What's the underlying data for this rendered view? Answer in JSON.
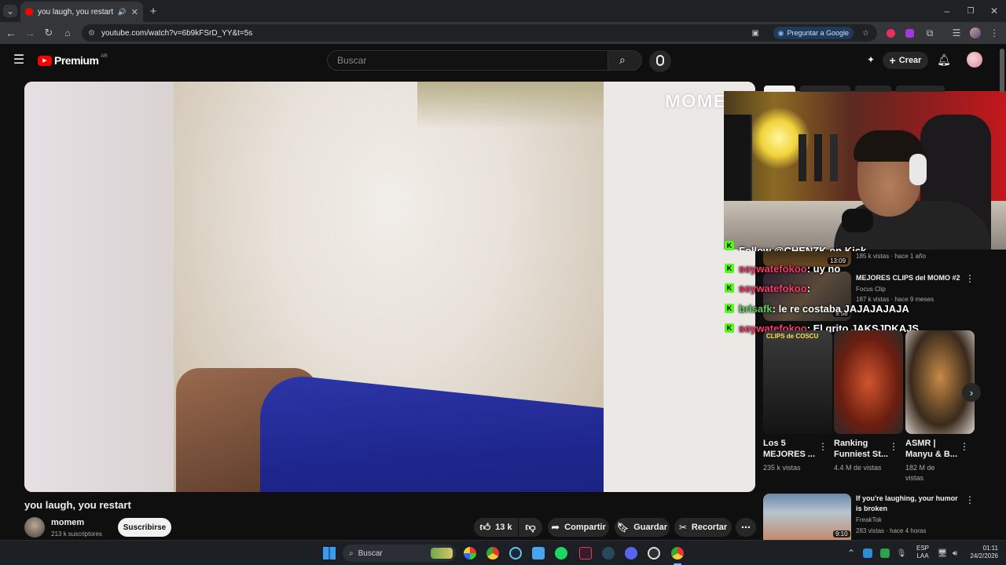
{
  "browser": {
    "tab_title": "you laugh, you restart - You",
    "url": "youtube.com/watch?v=6b9kFSrD_YY&t=5s",
    "ask_google": "Preguntar a Google"
  },
  "youtube": {
    "logo_text": "Premium",
    "logo_country": "AR",
    "search_placeholder": "Buscar",
    "create_label": "Crear"
  },
  "video": {
    "title": "you laugh, you restart",
    "watermark": "MOME",
    "channel_name": "momem",
    "subscribers": "213 k suscriptores",
    "subscribe_label": "Suscribirse",
    "likes": "13 k",
    "share_label": "Compartir",
    "save_label": "Guardar",
    "clip_label": "Recortar"
  },
  "chat": {
    "lines": [
      {
        "user": "soywatefokoo",
        "message": ": uy no",
        "user_color": "#ff3a6b"
      },
      {
        "user": "soywatefokoo",
        "message": ":",
        "user_color": "#ff3a6b"
      },
      {
        "user": "brisafk",
        "message": ": le re costaba JAJAJAJAJA",
        "user_color": "#5fd35f"
      },
      {
        "user": "soywatefokoo",
        "message": ": El grito JAKSJDKAJS",
        "user_color": "#ff3a6b"
      }
    ],
    "partial_line": "Follow @CHENZK on Kick"
  },
  "sidebar": {
    "partial_meta": "185 k vistas · hace 1 año",
    "partial_duration": "13:09",
    "rec1": {
      "title": "MEJORES CLIPS del MOMO #2",
      "channel": "Focus Clip",
      "meta": "187 k vistas · hace 9 meses",
      "duration": "9:58"
    },
    "shorts": [
      {
        "title": "Los 5 MEJORES ...",
        "views": "235 k vistas",
        "thumb_text": "CLIPS de COSCU"
      },
      {
        "title": "Ranking Funniest St...",
        "views": "4.4 M de vistas"
      },
      {
        "title": "ASMR | Manyu & B...",
        "views": "182 M de vistas"
      }
    ],
    "rec2": {
      "title": "If you're laughing, your humor is broken",
      "channel": "FreakTok",
      "meta": "283 vistas · hace 4 horas",
      "duration": "9:10"
    }
  },
  "taskbar": {
    "search_label": "Buscar",
    "lang_top": "ESP",
    "lang_bottom": "LAA",
    "time": "01:11",
    "date": "24/2/2026"
  },
  "colors": {
    "youtube_red": "#ff0000",
    "background": "#0f0f0f",
    "kick_green": "#53fc18"
  }
}
